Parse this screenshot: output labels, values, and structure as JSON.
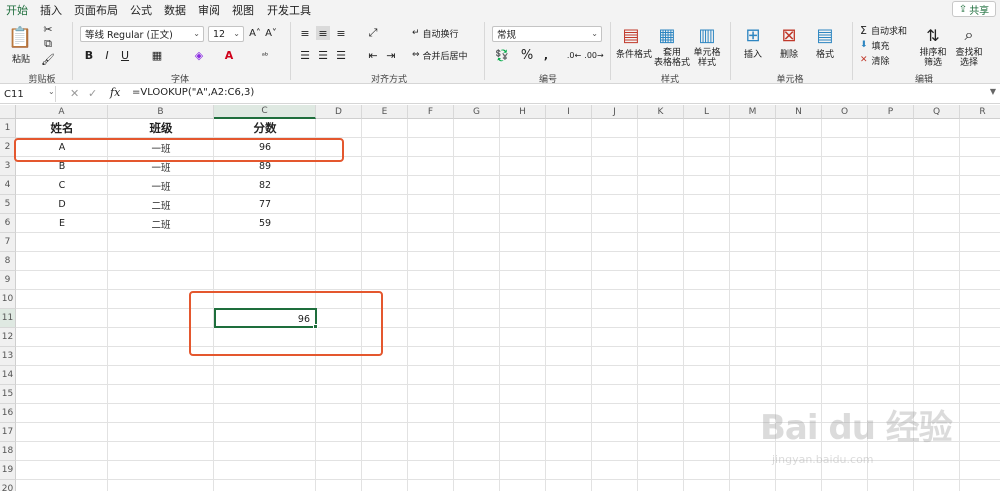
{
  "tabs": [
    "开始",
    "插入",
    "页面布局",
    "公式",
    "数据",
    "审阅",
    "视图",
    "开发工具"
  ],
  "share_label": "共享",
  "clipboard": {
    "paste": "粘贴",
    "group": "剪贴板"
  },
  "font": {
    "name": "等线 Regular (正文)",
    "size": "12",
    "bold": "B",
    "italic": "I",
    "underline": "U",
    "group": "字体"
  },
  "alignment": {
    "wrap": "自动换行",
    "merge": "合并后居中",
    "group": "对齐方式"
  },
  "number": {
    "format": "常规",
    "group": "编号"
  },
  "styles": {
    "conditional": "条件格式",
    "table_line1": "套用",
    "table_line2": "表格格式",
    "cell_line1": "单元格",
    "cell_line2": "样式",
    "group": "样式"
  },
  "cells": {
    "insert": "插入",
    "delete": "删除",
    "format": "格式",
    "group": "单元格"
  },
  "editing": {
    "autosum": "自动求和",
    "fill": "填充",
    "clear": "清除",
    "sort_line1": "排序和",
    "sort_line2": "筛选",
    "find_line1": "查找和",
    "find_line2": "选择",
    "group": "编辑"
  },
  "formula_bar": {
    "name_box": "C11",
    "fx": "fx",
    "formula": "=VLOOKUP(\"A\",A2:C6,3)"
  },
  "columns": [
    "A",
    "B",
    "C",
    "D",
    "E",
    "F",
    "G",
    "H",
    "I",
    "J",
    "K",
    "L",
    "M",
    "N",
    "O",
    "P",
    "Q",
    "R"
  ],
  "rows": [
    "1",
    "2",
    "3",
    "4",
    "5",
    "6",
    "7",
    "8",
    "9",
    "10",
    "11",
    "12",
    "13",
    "14",
    "15",
    "16",
    "17",
    "18",
    "19",
    "20"
  ],
  "table": {
    "headers": [
      "姓名",
      "班级",
      "分数"
    ],
    "rows": [
      [
        "A",
        "一班",
        "96"
      ],
      [
        "B",
        "一班",
        "89"
      ],
      [
        "C",
        "一班",
        "82"
      ],
      [
        "D",
        "二班",
        "77"
      ],
      [
        "E",
        "二班",
        "59"
      ]
    ]
  },
  "result_cell": "96",
  "watermark": {
    "logo": "Bai du 经验",
    "url": "jingyan.baidu.com"
  },
  "colors": {
    "accent": "#1e6e3c",
    "annotation": "#e4572e"
  }
}
